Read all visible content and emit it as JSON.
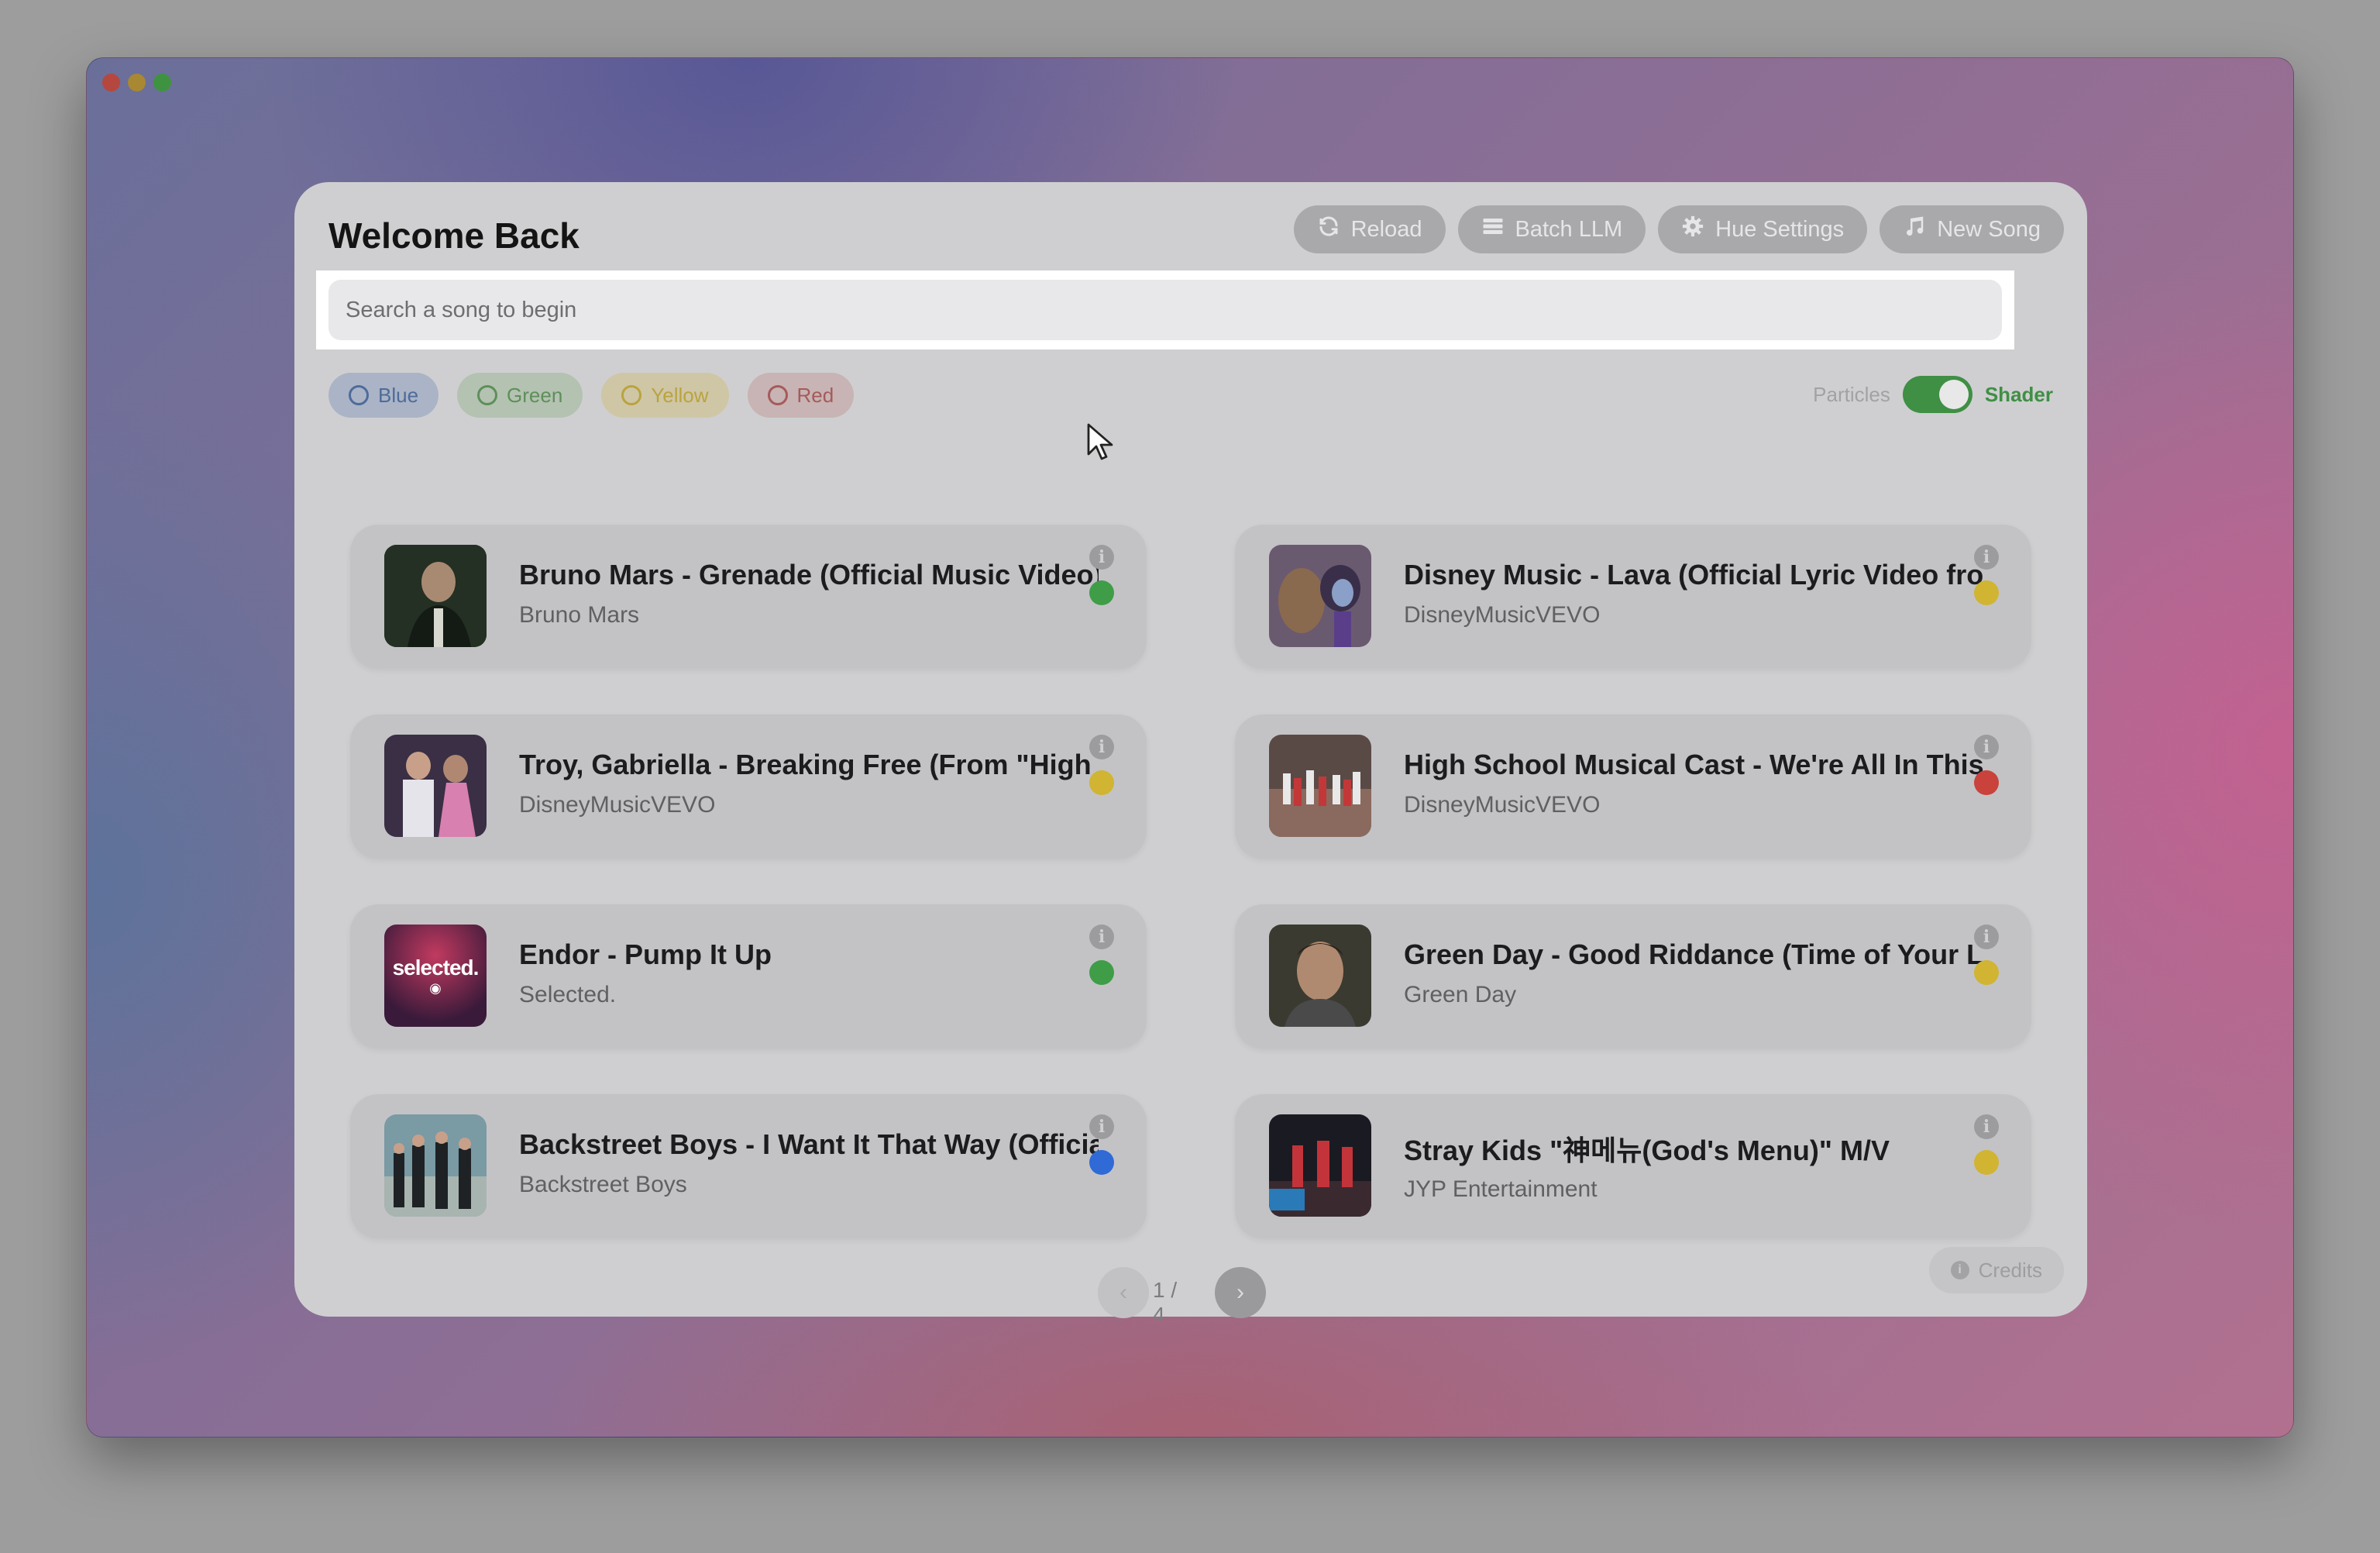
{
  "header": {
    "title": "Welcome Back"
  },
  "toolbar": {
    "reload": {
      "label": "Reload",
      "icon": "refresh-icon"
    },
    "batch": {
      "label": "Batch LLM",
      "icon": "list-icon"
    },
    "hue": {
      "label": "Hue Settings",
      "icon": "gear-icon"
    },
    "new_song": {
      "label": "New Song",
      "icon": "music-note-icon"
    }
  },
  "search": {
    "placeholder": "Search a song to begin",
    "value": ""
  },
  "filters": [
    {
      "label": "Blue",
      "color": "#4e6b9a"
    },
    {
      "label": "Green",
      "color": "#5e8f5a"
    },
    {
      "label": "Yellow",
      "color": "#b9a43e"
    },
    {
      "label": "Red",
      "color": "#a65a5a"
    }
  ],
  "mode_toggle": {
    "left_label": "Particles",
    "right_label": "Shader",
    "active": "Shader"
  },
  "songs": [
    {
      "title": "Bruno Mars - Grenade (Official Music Video)",
      "artist": "Bruno Mars",
      "status_color": "#3f9d47"
    },
    {
      "title": "Disney Music - Lava (Official Lyric Video from Lava)",
      "artist": "DisneyMusicVEVO",
      "status_color": "#d1b431"
    },
    {
      "title": "Troy, Gabriella - Breaking Free (From \"High School Musical\")",
      "artist": "DisneyMusicVEVO",
      "status_color": "#d1b431"
    },
    {
      "title": "High School Musical Cast - We're All In This Together",
      "artist": "DisneyMusicVEVO",
      "status_color": "#c9423c"
    },
    {
      "title": "Endor - Pump It Up",
      "artist": "Selected.",
      "status_color": "#3f9d47"
    },
    {
      "title": "Green Day - Good Riddance (Time of Your Life)",
      "artist": "Green Day",
      "status_color": "#d1b431"
    },
    {
      "title": "Backstreet Boys - I Want It That Way (Official Video)",
      "artist": "Backstreet Boys",
      "status_color": "#2f6ad6"
    },
    {
      "title": "Stray Kids \"神메뉴(God's Menu)\" M/V",
      "artist": "JYP Entertainment",
      "status_color": "#d1b431"
    }
  ],
  "thumb_labels": {
    "endor": "selected."
  },
  "pagination": {
    "label": "1 / 4"
  },
  "footer": {
    "credits_label": "Credits"
  },
  "window": {
    "controls": [
      "close",
      "minimize",
      "zoom"
    ]
  }
}
